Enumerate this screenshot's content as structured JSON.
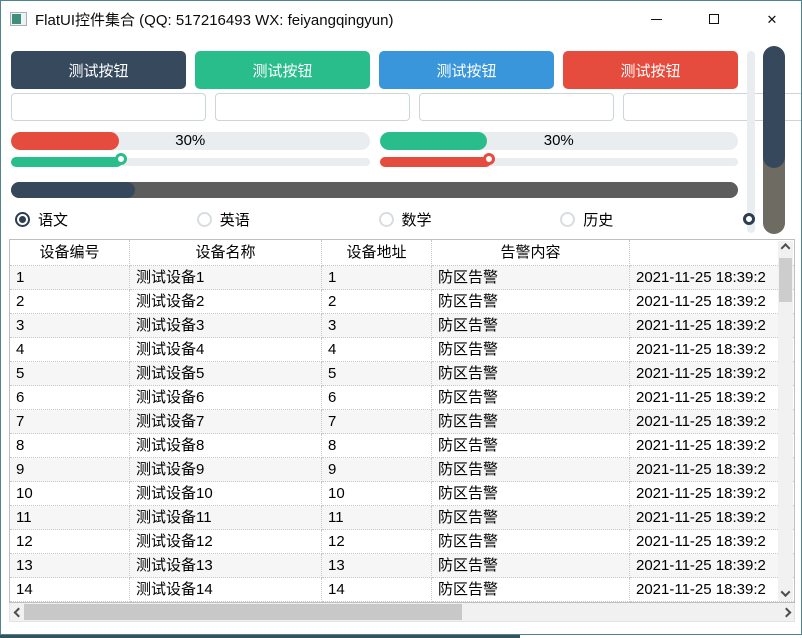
{
  "window": {
    "title": "FlatUI控件集合 (QQ: 517216493 WX: feiyangqingyun)",
    "close_glyph": "✕"
  },
  "colors": {
    "dark": "#37495d",
    "green": "#2abd8c",
    "blue": "#3a96da",
    "red": "#e64c3e",
    "navy": "#36495c",
    "dark_track": "#5d5d5d",
    "v_track_gray": "#6e6b63"
  },
  "buttons": [
    {
      "label": "测试按钮",
      "color": "#37495d"
    },
    {
      "label": "测试按钮",
      "color": "#2abd8c"
    },
    {
      "label": "测试按钮",
      "color": "#3a96da"
    },
    {
      "label": "测试按钮",
      "color": "#e64c3e"
    }
  ],
  "inputs": [
    {
      "value": ""
    },
    {
      "value": ""
    },
    {
      "value": ""
    },
    {
      "value": ""
    }
  ],
  "progress_bars": [
    {
      "label": "30%",
      "fill_width": "30%",
      "color": "#e64c3e"
    },
    {
      "label": "30%",
      "fill_width": "30%",
      "color": "#2abd8c"
    }
  ],
  "sliders": [
    {
      "fill_width": "31%",
      "handle_left": "29%",
      "color": "#2abd8c"
    },
    {
      "fill_width": "31%",
      "handle_left": "29%",
      "color": "#e64c3e"
    }
  ],
  "dark_progress": {
    "fill_width": "17%",
    "fill_color": "#36495c",
    "track_color": "#5d5d5d"
  },
  "radios": [
    {
      "label": "语文",
      "selected": true
    },
    {
      "label": "英语",
      "selected": false
    },
    {
      "label": "数学",
      "selected": false
    },
    {
      "label": "历史",
      "selected": false
    }
  ],
  "vertical_progress": {
    "fill_height": "65%",
    "fill_color": "#36495c",
    "track_color": "#6e6b63"
  },
  "table": {
    "headers": [
      "设备编号",
      "设备名称",
      "设备地址",
      "告警内容",
      ""
    ],
    "rows": [
      [
        "1",
        "测试设备1",
        "1",
        "防区告警",
        "2021-11-25 18:39:2"
      ],
      [
        "2",
        "测试设备2",
        "2",
        "防区告警",
        "2021-11-25 18:39:2"
      ],
      [
        "3",
        "测试设备3",
        "3",
        "防区告警",
        "2021-11-25 18:39:2"
      ],
      [
        "4",
        "测试设备4",
        "4",
        "防区告警",
        "2021-11-25 18:39:2"
      ],
      [
        "5",
        "测试设备5",
        "5",
        "防区告警",
        "2021-11-25 18:39:2"
      ],
      [
        "6",
        "测试设备6",
        "6",
        "防区告警",
        "2021-11-25 18:39:2"
      ],
      [
        "7",
        "测试设备7",
        "7",
        "防区告警",
        "2021-11-25 18:39:2"
      ],
      [
        "8",
        "测试设备8",
        "8",
        "防区告警",
        "2021-11-25 18:39:2"
      ],
      [
        "9",
        "测试设备9",
        "9",
        "防区告警",
        "2021-11-25 18:39:2"
      ],
      [
        "10",
        "测试设备10",
        "10",
        "防区告警",
        "2021-11-25 18:39:2"
      ],
      [
        "11",
        "测试设备11",
        "11",
        "防区告警",
        "2021-11-25 18:39:2"
      ],
      [
        "12",
        "测试设备12",
        "12",
        "防区告警",
        "2021-11-25 18:39:2"
      ],
      [
        "13",
        "测试设备13",
        "13",
        "防区告警",
        "2021-11-25 18:39:2"
      ],
      [
        "14",
        "测试设备14",
        "14",
        "防区告警",
        "2021-11-25 18:39:2"
      ]
    ]
  }
}
